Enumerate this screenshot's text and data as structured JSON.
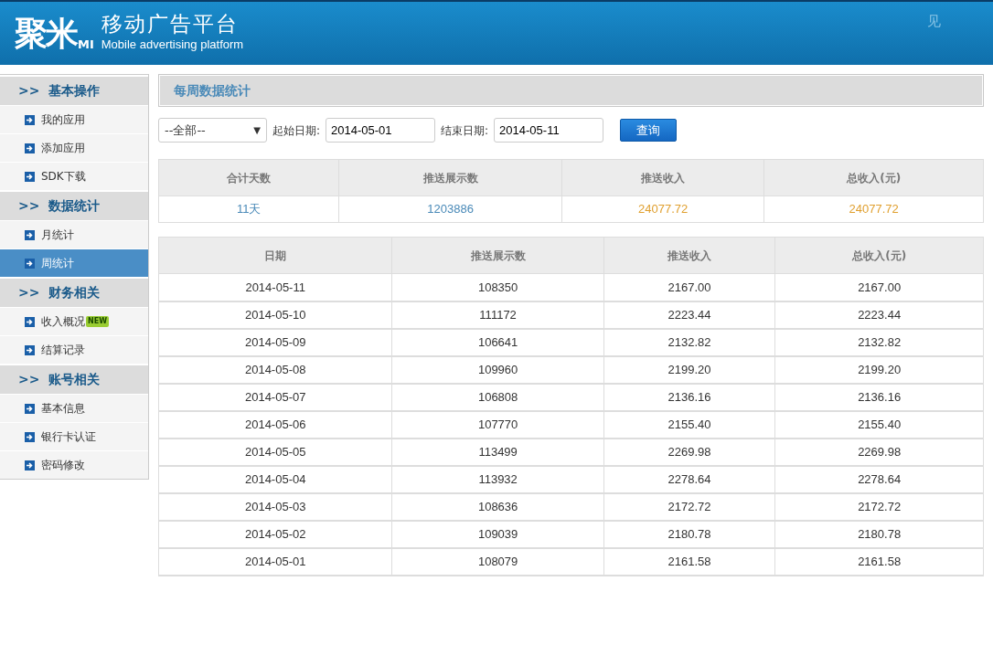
{
  "header": {
    "logo_main": "聚米",
    "logo_sub": "MI",
    "title": "移动广告平台",
    "subtitle": "Mobile advertising platform",
    "corner_text": "见"
  },
  "sidebar": {
    "groups": [
      {
        "marker": ">>",
        "title": "基本操作",
        "items": [
          {
            "label": "我的应用",
            "selected": false
          },
          {
            "label": "添加应用",
            "selected": false
          },
          {
            "label": "SDK下载",
            "selected": false
          }
        ]
      },
      {
        "marker": ">>",
        "title": "数据统计",
        "items": [
          {
            "label": "月统计",
            "selected": false
          },
          {
            "label": "周统计",
            "selected": true
          }
        ]
      },
      {
        "marker": ">>",
        "title": "财务相关",
        "items": [
          {
            "label": "收入概况",
            "selected": false,
            "badge": "NEW"
          },
          {
            "label": "结算记录",
            "selected": false
          }
        ]
      },
      {
        "marker": ">>",
        "title": "账号相关",
        "items": [
          {
            "label": "基本信息",
            "selected": false
          },
          {
            "label": "银行卡认证",
            "selected": false
          },
          {
            "label": "密码修改",
            "selected": false
          }
        ]
      }
    ]
  },
  "main": {
    "title": "每周数据统计",
    "filter": {
      "app_select": "--全部--",
      "select_caret": "▼",
      "start_label": "起始日期:",
      "start_value": "2014-05-01",
      "end_label": "结束日期:",
      "end_value": "2014-05-11",
      "query_button": "查询"
    },
    "summary": {
      "columns": [
        "合计天数",
        "推送展示数",
        "推送收入",
        "总收入(元)"
      ],
      "values": [
        {
          "text": "11天",
          "color": "#4a8ab8"
        },
        {
          "text": "1203886",
          "color": "#4a8ab8"
        },
        {
          "text": "24077.72",
          "color": "#e0a030"
        },
        {
          "text": "24077.72",
          "color": "#e0a030"
        }
      ]
    },
    "table": {
      "columns": [
        "日期",
        "推送展示数",
        "推送收入",
        "总收入(元)"
      ],
      "rows": [
        [
          "2014-05-11",
          "108350",
          "2167.00",
          "2167.00"
        ],
        [
          "2014-05-10",
          "111172",
          "2223.44",
          "2223.44"
        ],
        [
          "2014-05-09",
          "106641",
          "2132.82",
          "2132.82"
        ],
        [
          "2014-05-08",
          "109960",
          "2199.20",
          "2199.20"
        ],
        [
          "2014-05-07",
          "106808",
          "2136.16",
          "2136.16"
        ],
        [
          "2014-05-06",
          "107770",
          "2155.40",
          "2155.40"
        ],
        [
          "2014-05-05",
          "113499",
          "2269.98",
          "2269.98"
        ],
        [
          "2014-05-04",
          "113932",
          "2278.64",
          "2278.64"
        ],
        [
          "2014-05-03",
          "108636",
          "2172.72",
          "2172.72"
        ],
        [
          "2014-05-02",
          "109039",
          "2180.78",
          "2180.78"
        ],
        [
          "2014-05-01",
          "108079",
          "2161.58",
          "2161.58"
        ]
      ]
    }
  }
}
